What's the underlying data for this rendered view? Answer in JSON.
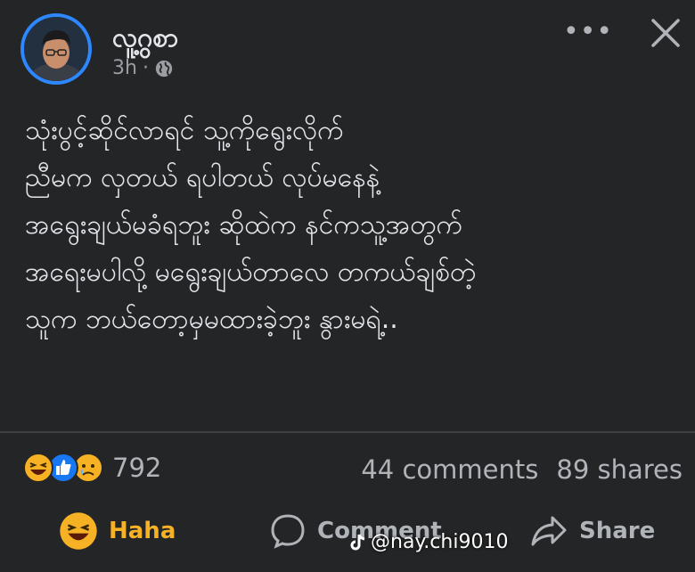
{
  "post": {
    "author": "လူ့ဂွစာ",
    "time": "3h",
    "dot": "·",
    "privacy_icon": "globe-icon",
    "lines": [
      "သုံးပွင့်ဆိုင်လာရင် သူ့ကိုရွေးလိုက်",
      "ညီမက လှတယ် ရပါတယ် လုပ်မနေနဲ့",
      "အရွေးချယ်မခံရဘူး ဆိုထဲက နင်ကသူ့အတွက်",
      "အရေးမပါလို့ မရွေးချယ်တာလေ တကယ်ချစ်တဲ့",
      "သူက ဘယ်တော့မှမထားခဲ့ဘူး နွားမရဲ့.."
    ]
  },
  "header": {
    "more_label": "•••",
    "more_icon": "more-dots-icon",
    "close_icon": "close-icon"
  },
  "reactions": {
    "icons": [
      "haha",
      "like",
      "sad"
    ],
    "count": "792"
  },
  "stats": {
    "comments": "44 comments",
    "shares": "89 shares"
  },
  "actions": {
    "haha": "Haha",
    "comment": "Comment",
    "share": "Share"
  },
  "watermark": {
    "handle": "@nay.chi9010"
  },
  "colors": {
    "background": "#242526",
    "haha": "#f7b125",
    "like": "#1877f2",
    "avatar_ring": "#2d88ff"
  }
}
